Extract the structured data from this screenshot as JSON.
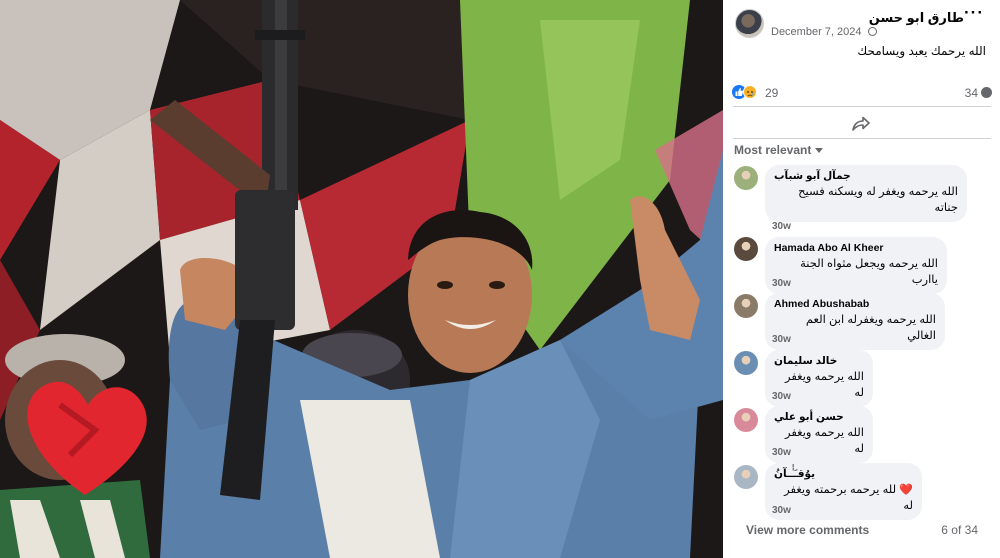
{
  "post": {
    "author": "طارق ابو حسن",
    "date": "December 7, 2024",
    "privacy_icon": "globe-icon",
    "text": "الله يرحمك يعبد ويسامحك",
    "menu_icon": "more-dots-icon"
  },
  "stats": {
    "reaction_icons": [
      "like-icon",
      "sad-icon"
    ],
    "reaction_count": "29",
    "comment_count": "34",
    "comment_icon": "comment-bubble-icon"
  },
  "actions": {
    "share_icon": "share-icon"
  },
  "comments_section": {
    "sort_label": "Most relevant",
    "view_more_label": "View more comments",
    "pager": "6 of 34"
  },
  "comments": [
    {
      "name": "جمآل آبو شبآب",
      "text": "الله يرحمه ويغفر له ويسكنه فسيح جناته",
      "time": "30w",
      "avatar_color": "#9bb07a"
    },
    {
      "name": "Hamada Abo Al Kheer",
      "text": "الله يرحمه ويجعل مثواه الجنة ياارب",
      "time": "30w",
      "avatar_color": "#5a4a3e"
    },
    {
      "name": "Ahmed Abushabab",
      "text": "الله يرحمه ويغفرله ابن العم الغالي",
      "time": "30w",
      "avatar_color": "#8a7a68"
    },
    {
      "name": "خالد سليمان",
      "text": "الله يرحمه ويغفر له",
      "time": "30w",
      "avatar_color": "#6a8fb3"
    },
    {
      "name": "حسن أبو علي",
      "text": "الله يرحمه ويغفر له",
      "time": "30w",
      "avatar_color": "#d98a9a"
    },
    {
      "name": "يوُقـَـٰٰـآنُ",
      "text": "لله يرحمه برحمته ويغفر له",
      "text_emoji": "❤️",
      "time": "30w",
      "avatar_color": "#a9b6c4"
    }
  ],
  "colors": {
    "accent_blue": "#1877f2",
    "secondary_text": "#65676b",
    "bubble_bg": "#f0f2f5",
    "heart_red": "#e4253b"
  }
}
